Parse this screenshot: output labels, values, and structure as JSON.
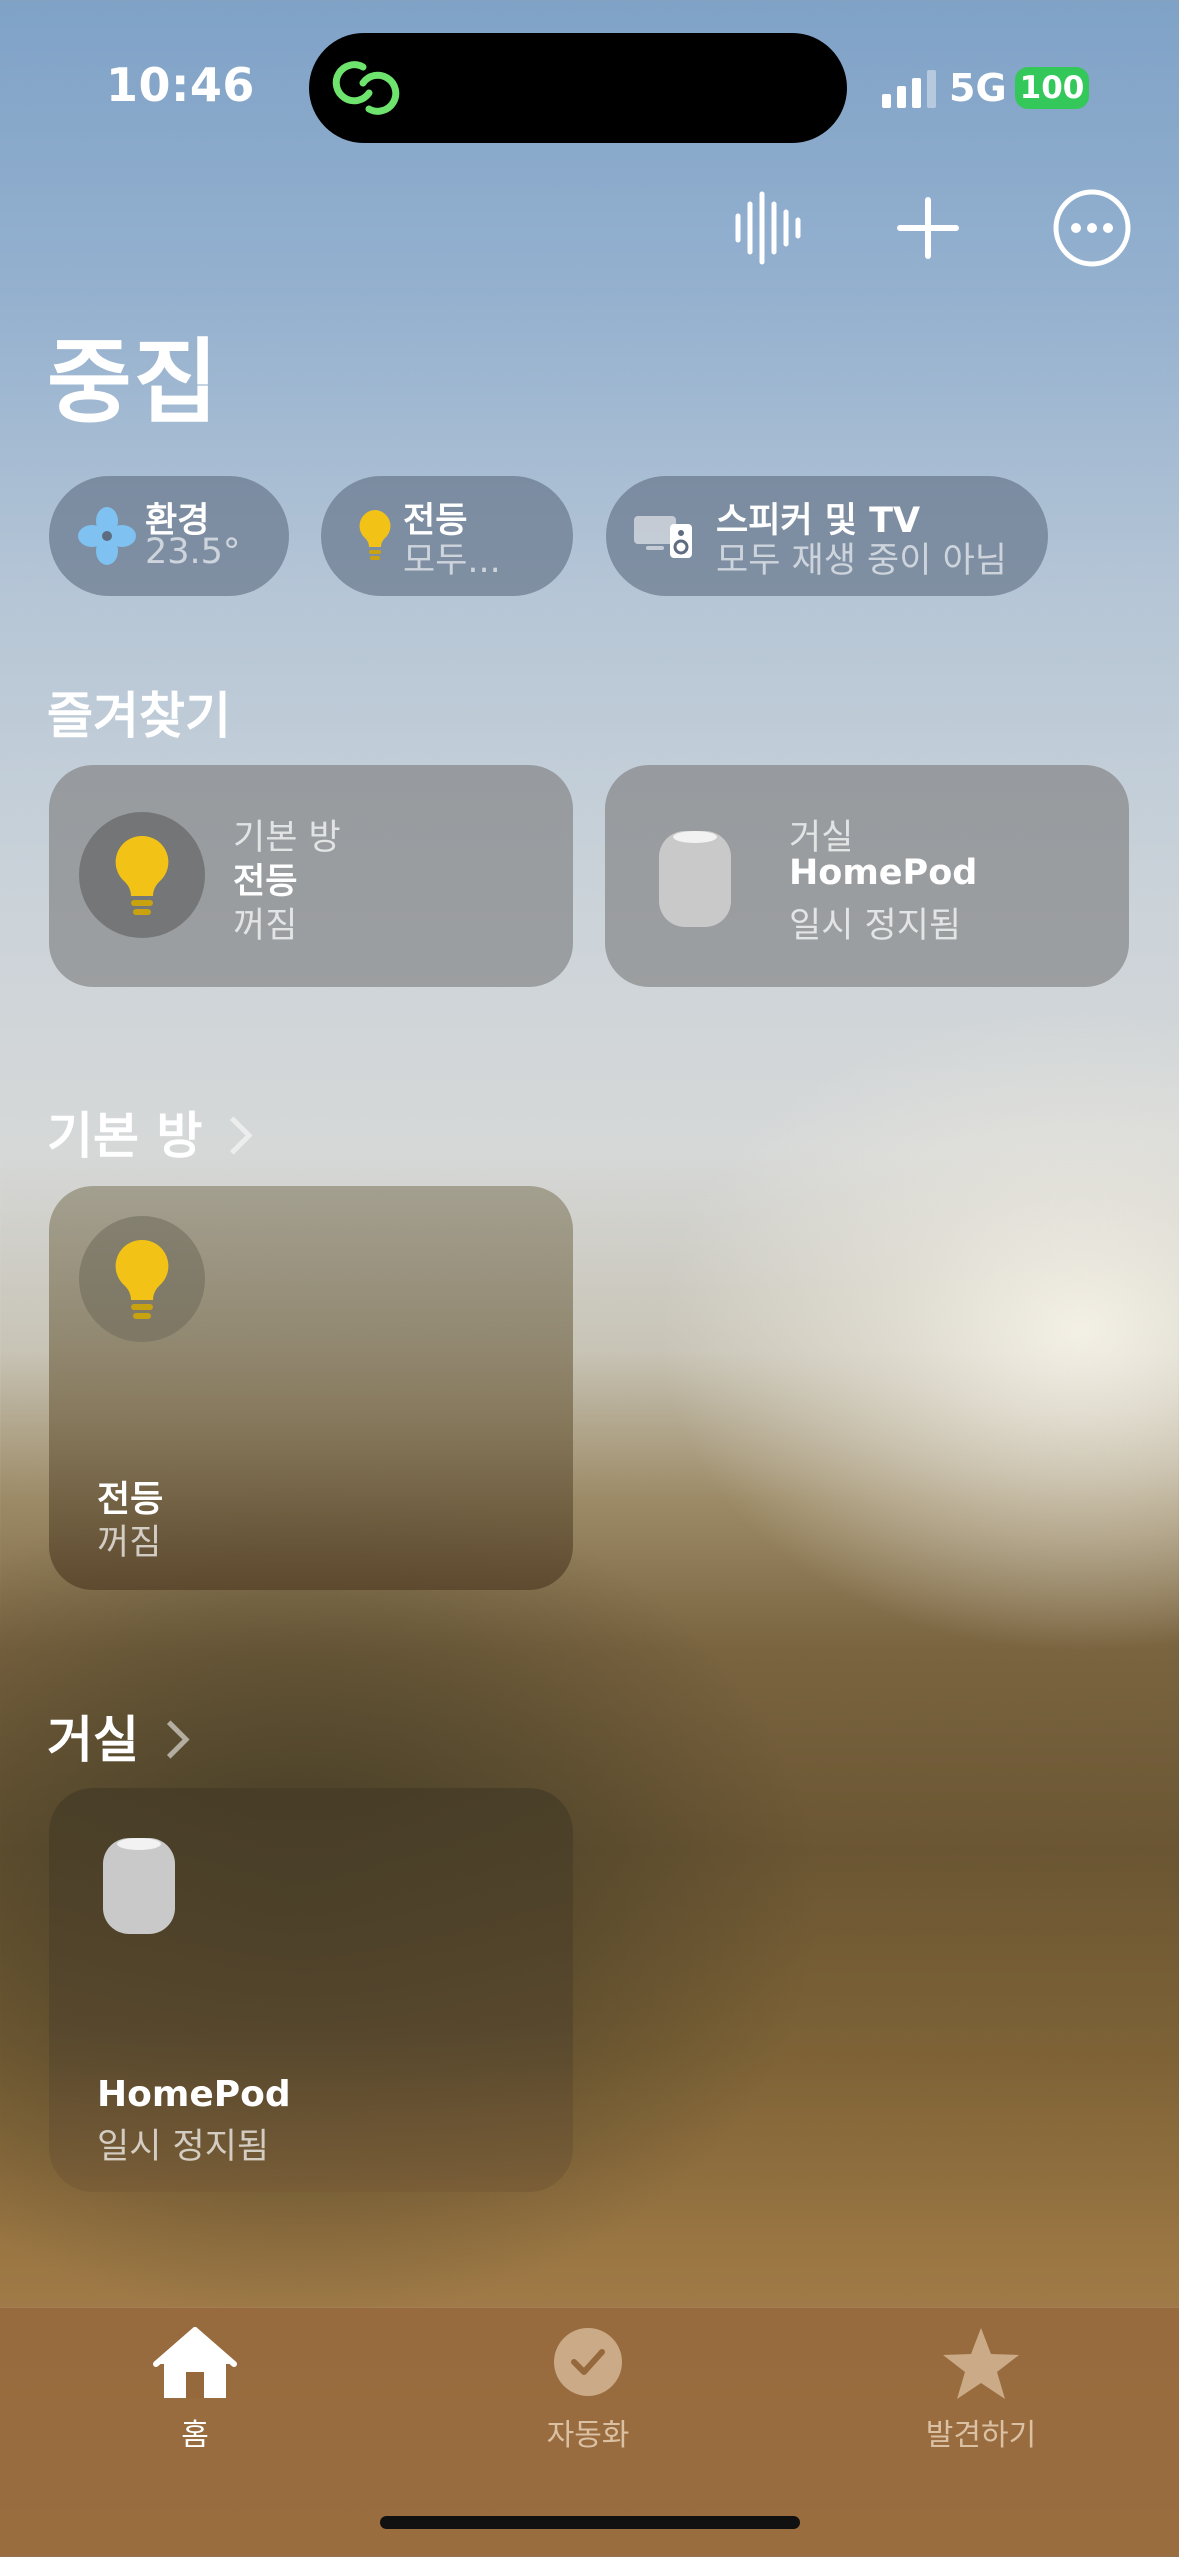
{
  "status_bar": {
    "time": "10:46",
    "network": "5G",
    "battery": "100"
  },
  "home": {
    "title": "중집"
  },
  "summary_pills": [
    {
      "label": "환경",
      "value": "23.5°",
      "icon": "fan-icon"
    },
    {
      "label": "전등",
      "value": "모두...",
      "icon": "lightbulb-icon"
    },
    {
      "label": "스피커 및 TV",
      "value": "모두 재생 중이 아님",
      "icon": "speaker-tv-icon"
    }
  ],
  "favorites": {
    "title": "즐겨찾기",
    "tiles": [
      {
        "room": "기본 방",
        "name": "전등",
        "state": "꺼짐",
        "icon": "lightbulb-icon"
      },
      {
        "room": "거실",
        "name": "HomePod",
        "state": "일시 정지됨",
        "icon": "homepod-icon"
      }
    ]
  },
  "rooms": [
    {
      "title": "기본 방",
      "tile": {
        "name": "전등",
        "state": "꺼짐",
        "icon": "lightbulb-icon"
      }
    },
    {
      "title": "거실",
      "tile": {
        "name": "HomePod",
        "state": "일시 정지됨",
        "icon": "homepod-icon"
      }
    }
  ],
  "tabs": [
    {
      "label": "홈",
      "icon": "house-icon",
      "selected": true
    },
    {
      "label": "자동화",
      "icon": "automation-icon",
      "selected": false
    },
    {
      "label": "발견하기",
      "icon": "star-icon",
      "selected": false
    }
  ],
  "colors": {
    "accent_yellow": "#f2c316",
    "battery_green": "#34c759",
    "link_icon_green": "#6ee36e"
  }
}
